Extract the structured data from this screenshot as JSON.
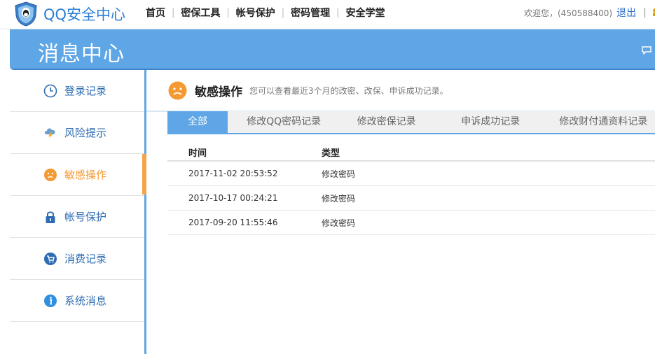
{
  "header": {
    "logo_text": "QQ安全中心",
    "nav": [
      {
        "label": "首页"
      },
      {
        "label": "密保工具"
      },
      {
        "label": "帐号保护"
      },
      {
        "label": "密码管理"
      },
      {
        "label": "安全学堂"
      }
    ],
    "separator": "|",
    "welcome": "欢迎您，(450588400)",
    "logout": "退出",
    "user_separator": "|"
  },
  "banner": {
    "title": "消息中心"
  },
  "sidebar": {
    "items": [
      {
        "label": "登录记录",
        "icon": "clock-icon"
      },
      {
        "label": "风险提示",
        "icon": "lightning-cloud-icon"
      },
      {
        "label": "敏感操作",
        "icon": "sad-face-icon",
        "active": true
      },
      {
        "label": "帐号保护",
        "icon": "lock-icon"
      },
      {
        "label": "消费记录",
        "icon": "cart-icon"
      },
      {
        "label": "系统消息",
        "icon": "info-icon"
      }
    ]
  },
  "main": {
    "title": "敏感操作",
    "description": "您可以查看最近3个月的改密、改保、申诉成功记录。",
    "tabs": [
      {
        "label": "全部",
        "active": true
      },
      {
        "label": "修改QQ密码记录"
      },
      {
        "label": "修改密保记录"
      },
      {
        "label": "申诉成功记录"
      },
      {
        "label": "修改财付通资料记录"
      }
    ],
    "table": {
      "headers": {
        "time": "时间",
        "type": "类型"
      },
      "rows": [
        {
          "time": "2017-11-02 20:53:52",
          "type": "修改密码"
        },
        {
          "time": "2017-10-17 00:24:21",
          "type": "修改密码"
        },
        {
          "time": "2017-09-20 11:55:46",
          "type": "修改密码"
        }
      ]
    }
  },
  "colors": {
    "brand_blue": "#5ea6e6",
    "link_blue": "#2e6db3",
    "active_orange": "#f39a33"
  }
}
